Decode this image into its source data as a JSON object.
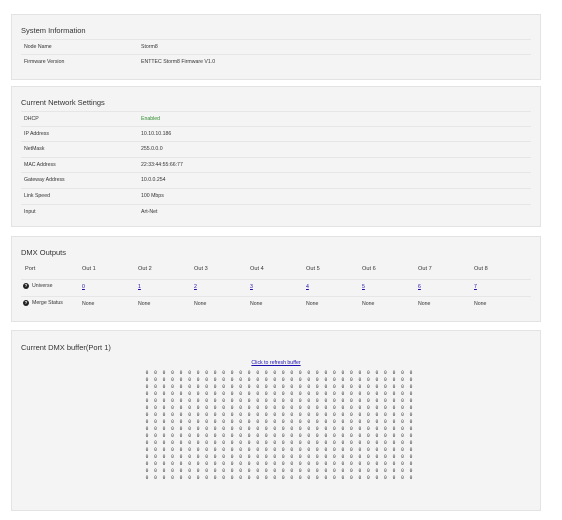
{
  "system": {
    "title": "System Information",
    "rows": [
      {
        "label": "Node Name",
        "value": "Storm8"
      },
      {
        "label": "Firmware Version",
        "value": "ENTTEC Storm8 Firmware V1.0"
      }
    ]
  },
  "network": {
    "title": "Current Network Settings",
    "rows": [
      {
        "label": "DHCP",
        "value": "Enabled"
      },
      {
        "label": "IP Address",
        "value": "10.10.10.186"
      },
      {
        "label": "NetMask",
        "value": "255.0.0.0"
      },
      {
        "label": "MAC Address",
        "value": "22:33:44:55:66:77"
      },
      {
        "label": "Gateway Address",
        "value": "10.0.0.254"
      },
      {
        "label": "Link Speed",
        "value": "100 Mbps"
      },
      {
        "label": "Input",
        "value": "Art-Net"
      }
    ],
    "status_color": "#2e8b2e"
  },
  "dmx": {
    "title": "DMX Outputs",
    "port_header": "Port",
    "outputs": [
      "Out 1",
      "Out 2",
      "Out 3",
      "Out 4",
      "Out 5",
      "Out 6",
      "Out 7",
      "Out 8"
    ],
    "universe_label": "Universe",
    "universes": [
      "0",
      "1",
      "2",
      "3",
      "4",
      "5",
      "6",
      "7"
    ],
    "merge_label": "Merge Status",
    "merge": [
      "None",
      "None",
      "None",
      "None",
      "None",
      "None",
      "None",
      "None"
    ],
    "help_icon": "question-circle-icon"
  },
  "buffer": {
    "title": "Current DMX buffer(Port 1)",
    "refresh_label": "Click to refresh buffer",
    "value": "0",
    "columns": 32,
    "rows": 16
  },
  "link_color": "#1a0dab"
}
